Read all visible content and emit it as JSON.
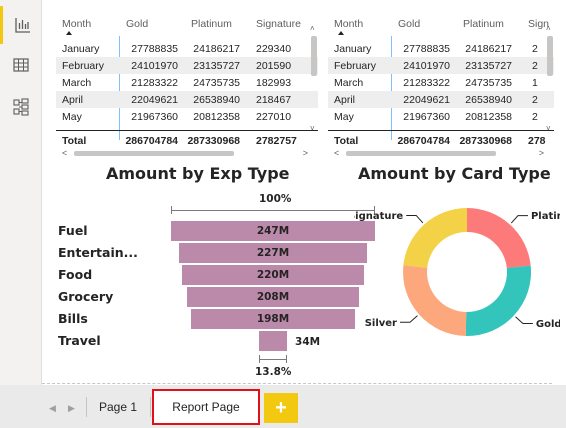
{
  "sidebar": {
    "items": [
      {
        "name": "report-view",
        "icon": "bar-chart-icon",
        "active": true
      },
      {
        "name": "data-view",
        "icon": "table-grid-icon",
        "active": false
      },
      {
        "name": "model-view",
        "icon": "model-diagram-icon",
        "active": false
      }
    ],
    "accent_color": "#f2c811"
  },
  "table_left": {
    "headers": [
      "Month",
      "Gold",
      "Platinum",
      "Signature"
    ],
    "rows": [
      [
        "January",
        "27788835",
        "24186217",
        "229340"
      ],
      [
        "February",
        "24101970",
        "23135727",
        "201590"
      ],
      [
        "March",
        "21283322",
        "24735735",
        "182993"
      ],
      [
        "April",
        "22049621",
        "26538940",
        "218467"
      ],
      [
        "May",
        "21967360",
        "20812358",
        "227010"
      ]
    ],
    "total": [
      "Total",
      "286704784",
      "287330968",
      "2782757"
    ]
  },
  "table_right": {
    "headers": [
      "Month",
      "Gold",
      "Platinum",
      "Sign"
    ],
    "rows": [
      [
        "January",
        "27788835",
        "24186217",
        "2"
      ],
      [
        "February",
        "24101970",
        "23135727",
        "2"
      ],
      [
        "March",
        "21283322",
        "24735735",
        "1"
      ],
      [
        "April",
        "22049621",
        "26538940",
        "2"
      ],
      [
        "May",
        "21967360",
        "20812358",
        "2"
      ]
    ],
    "total": [
      "Total",
      "286704784",
      "287330968",
      "278"
    ]
  },
  "chart_data": [
    {
      "type": "funnel",
      "title": "Amount by Exp Type",
      "categories": [
        "Fuel",
        "Entertain...",
        "Food",
        "Grocery",
        "Bills",
        "Travel"
      ],
      "values": [
        247,
        227,
        220,
        208,
        198,
        34
      ],
      "value_labels": [
        "247M",
        "227M",
        "220M",
        "208M",
        "198M",
        "34M"
      ],
      "top_percent_label": "100%",
      "bottom_percent_label": "13.8%",
      "color": "#bb8aab"
    },
    {
      "type": "pie",
      "donut": true,
      "title": "Amount by Card Type",
      "categories": [
        "Platinum",
        "Gold",
        "Silver",
        "Signature"
      ],
      "values": [
        23.4,
        26.9,
        26.4,
        23.3
      ],
      "colors": [
        "#fd7a7a",
        "#33c4bb",
        "#fda77d",
        "#f4d248"
      ]
    }
  ],
  "page_tabs": {
    "tabs": [
      {
        "label": "Page 1",
        "active": false
      },
      {
        "label": "Report Page",
        "active": true
      }
    ],
    "add_label": "+",
    "prev_icon": "chevron-left-icon",
    "next_icon": "chevron-right-icon",
    "active_outline_color": "#e0101c"
  }
}
